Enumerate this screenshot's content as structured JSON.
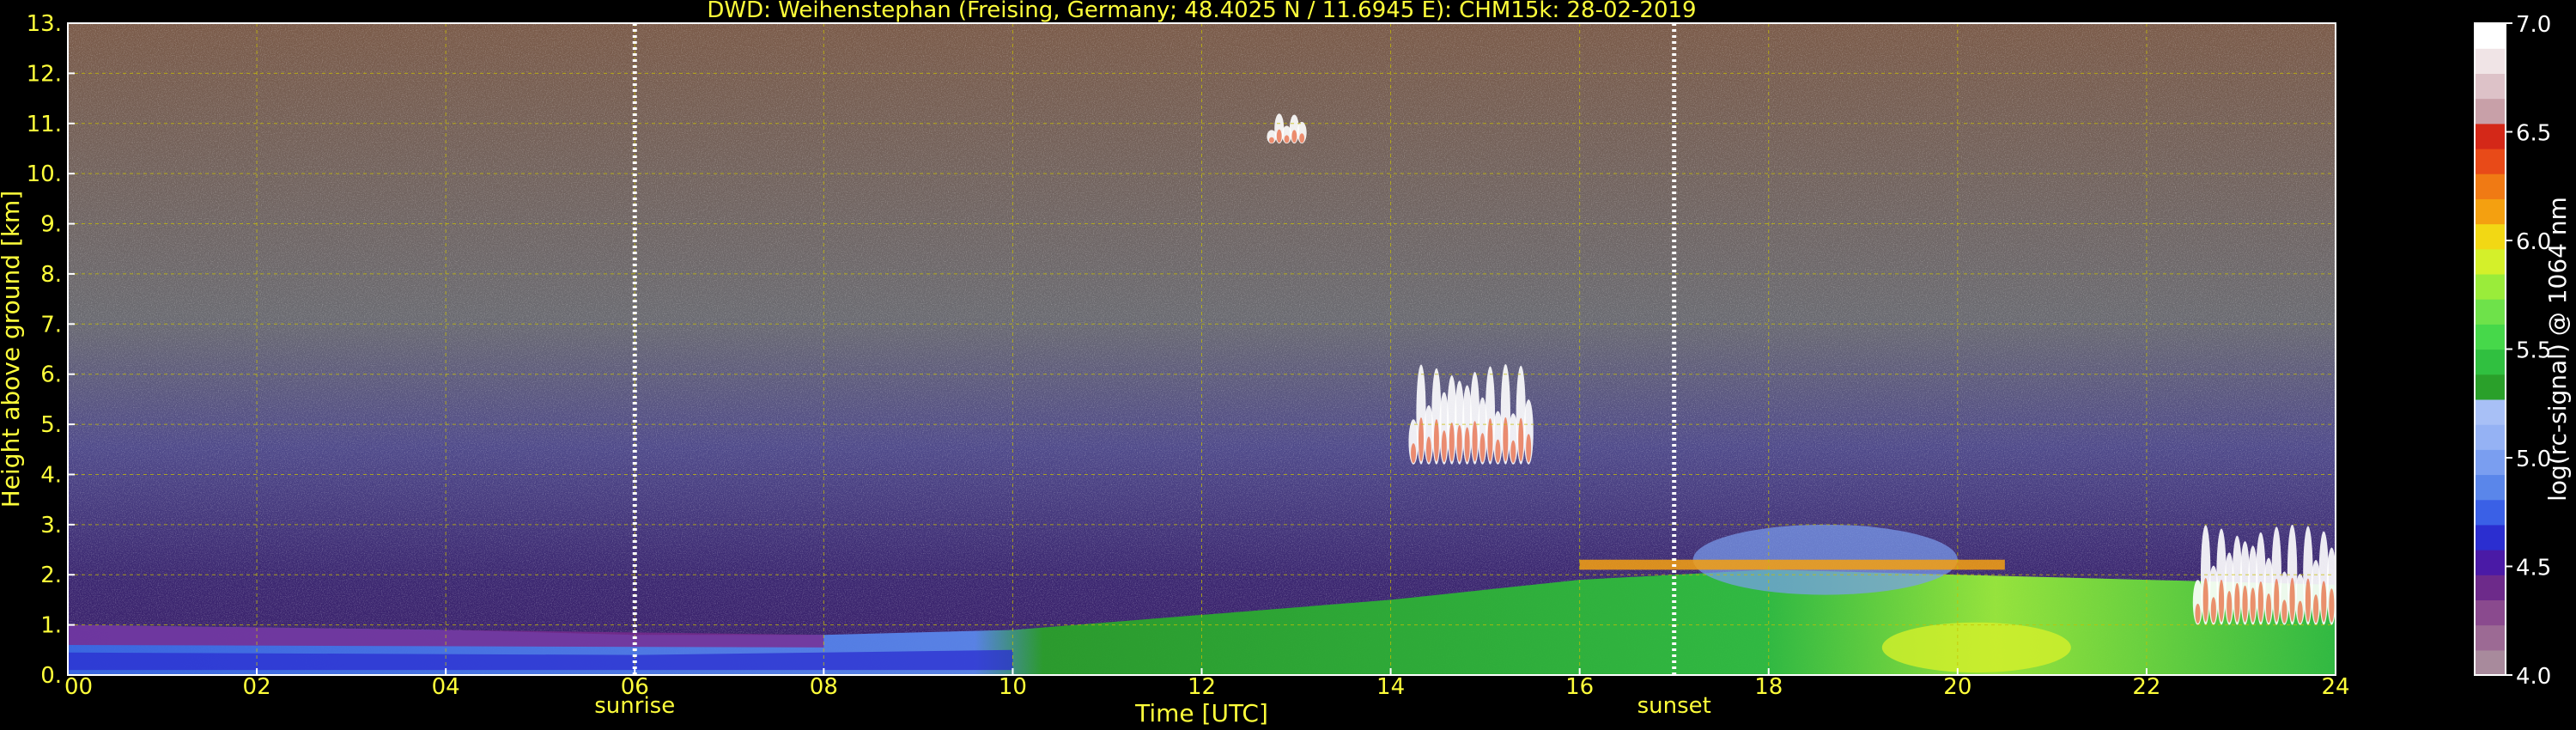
{
  "chart_data": {
    "type": "heatmap",
    "title": "DWD: Weihenstephan (Freising, Germany; 48.4025 N / 11.6945 E):    CHM15k: 28-02-2019",
    "xlabel": "Time [UTC]",
    "ylabel": "Height above ground [km]",
    "xlim": [
      0,
      24
    ],
    "ylim": [
      0,
      13
    ],
    "x_ticks": [
      "00",
      "02",
      "04",
      "06",
      "08",
      "10",
      "12",
      "14",
      "16",
      "18",
      "20",
      "22",
      "24"
    ],
    "y_ticks": [
      "0.",
      "1.",
      "2.",
      "3.",
      "4.",
      "5.",
      "6.",
      "7.",
      "8.",
      "9.",
      "10.",
      "11.",
      "12.",
      "13."
    ],
    "grid": true,
    "vertical_markers": [
      {
        "label": "sunrise",
        "x": 6.0
      },
      {
        "label": "sunset",
        "x": 17.0
      }
    ],
    "colorbar": {
      "label": "log(rc-signal) @ 1064 nm",
      "range": [
        4.0,
        7.0
      ],
      "ticks": [
        "4.0",
        "4.5",
        "5.0",
        "5.5",
        "6.0",
        "6.5",
        "7.0"
      ],
      "colors": [
        "#a88a9c",
        "#9c6a94",
        "#8a4a8e",
        "#6d2a8a",
        "#4a1aa6",
        "#2b2ed0",
        "#3a60e6",
        "#5a86ea",
        "#7a9ef0",
        "#95b2f4",
        "#a8c0f6",
        "#2aa02a",
        "#30c040",
        "#46d84a",
        "#6ee24a",
        "#9aec3a",
        "#d4f02a",
        "#f2d814",
        "#f4a010",
        "#f07a14",
        "#e84a18",
        "#d42818",
        "#c8a0a8",
        "#ddc2c8",
        "#f0e4e6",
        "#ffffff"
      ]
    },
    "layers": [
      {
        "name": "aerosol_layer_top",
        "x": [
          0,
          2,
          4,
          6,
          8,
          10,
          12,
          14,
          16,
          18,
          20,
          22,
          24
        ],
        "y": [
          1.0,
          0.95,
          0.9,
          0.8,
          0.8,
          0.9,
          1.2,
          1.5,
          1.9,
          2.1,
          2.0,
          1.9,
          1.8
        ]
      },
      {
        "name": "cloud_cirrus",
        "x": [
          12.7,
          13.1
        ],
        "y": [
          10.6,
          11.2
        ]
      },
      {
        "name": "cloud_mid",
        "x": [
          14.2,
          15.5
        ],
        "y": [
          4.2,
          6.2
        ]
      },
      {
        "name": "cloud_low_evening",
        "x": [
          22.5,
          24.0
        ],
        "y": [
          1.0,
          3.0
        ]
      }
    ]
  }
}
